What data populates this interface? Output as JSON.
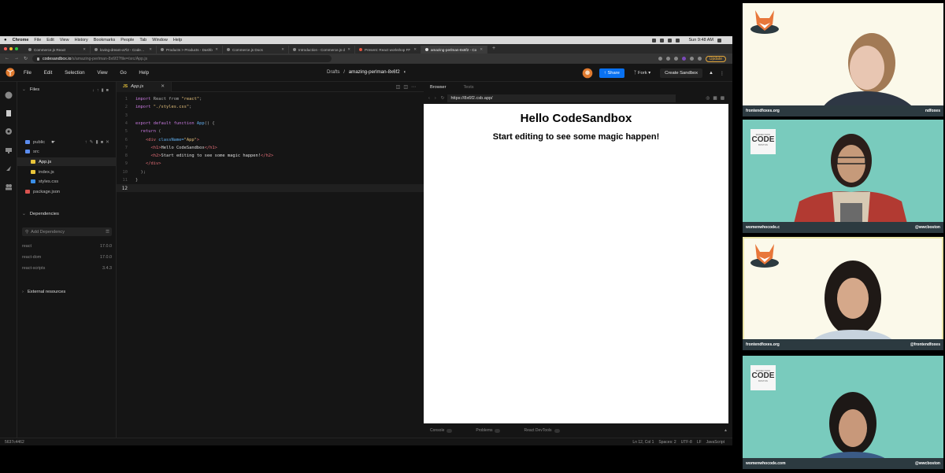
{
  "menubar": {
    "items": [
      "Chrome",
      "File",
      "Edit",
      "View",
      "History",
      "Bookmarks",
      "People",
      "Tab",
      "Window",
      "Help"
    ],
    "clock": "Sun 9:48 AM"
  },
  "browser": {
    "tabs": [
      {
        "title": "Commerce.js React"
      },
      {
        "title": "loving-dream-a7l2 - CodeSan"
      },
      {
        "title": "Products > Products - Dashb"
      },
      {
        "title": "Commerce.js Docs"
      },
      {
        "title": "Introduction - Commerce.js d"
      },
      {
        "title": "Present: React workshop FF"
      },
      {
        "title": "amazing-perlman-8x6f2 - Co"
      }
    ],
    "url_host": "codesandbox.io",
    "url_path": "/s/amazing-perlman-8x6f2?file=/src/App.js",
    "update_label": "Update"
  },
  "csb": {
    "menu": [
      "File",
      "Edit",
      "Selection",
      "View",
      "Go",
      "Help"
    ],
    "breadcrumb_folder": "Drafts",
    "breadcrumb_sep": "/",
    "sandbox_name": "amazing-perlman-8x6f2",
    "share_label": "Share",
    "fork_label": "Fork",
    "create_label": "Create Sandbox",
    "files_header": "Files",
    "tree": [
      {
        "name": "public",
        "type": "folder"
      },
      {
        "name": "src",
        "type": "folder"
      },
      {
        "name": "App.js",
        "type": "js"
      },
      {
        "name": "index.js",
        "type": "js"
      },
      {
        "name": "styles.css",
        "type": "css"
      },
      {
        "name": "package.json",
        "type": "json"
      }
    ],
    "dependencies_header": "Dependencies",
    "dep_search_placeholder": "Add Dependency",
    "dependencies": [
      {
        "name": "react",
        "version": "17.0.0"
      },
      {
        "name": "react-dom",
        "version": "17.0.0"
      },
      {
        "name": "react-scripts",
        "version": "3.4.3"
      }
    ],
    "external_header": "External resources",
    "editor_tab": "App.js",
    "code_lines": [
      {
        "n": "1",
        "a": "import",
        "b": " React from ",
        "c": "\"react\"",
        "d": ";"
      },
      {
        "n": "2",
        "a": "import",
        "b": " ",
        "c": "\"./styles.css\"",
        "d": ";"
      },
      {
        "n": "3",
        "a": "",
        "b": "",
        "c": "",
        "d": ""
      },
      {
        "n": "4",
        "a": "export default function",
        "b": " ",
        "c": "App",
        "d": "() {"
      },
      {
        "n": "5",
        "a": "  return",
        "b": " (",
        "c": "",
        "d": ""
      },
      {
        "n": "6",
        "a": "    <div",
        "b": " className=",
        "c": "\"App\"",
        "d": ">"
      },
      {
        "n": "7",
        "a": "      <h1>",
        "b": "Hello CodeSandbox",
        "c": "</h1>",
        "d": ""
      },
      {
        "n": "8",
        "a": "      <h2>",
        "b": "Start editing to see some magic happen!",
        "c": "</h2>",
        "d": ""
      },
      {
        "n": "9",
        "a": "    </div>",
        "b": "",
        "c": "",
        "d": ""
      },
      {
        "n": "10",
        "a": "  );",
        "b": "",
        "c": "",
        "d": ""
      },
      {
        "n": "11",
        "a": "}",
        "b": "",
        "c": "",
        "d": ""
      },
      {
        "n": "12",
        "a": "",
        "b": "",
        "c": "",
        "d": ""
      }
    ],
    "preview_tab": "Browser",
    "tests_tab": "Tests",
    "preview_url": "https://8x6f2.csb.app/",
    "preview_h1": "Hello CodeSandbox",
    "preview_h2": "Start editing to see some magic happen!",
    "bottom_tabs": [
      "Console",
      "Problems",
      "React DevTools"
    ],
    "status_left": "5637c4462",
    "status_right": [
      "Ln 12, Col 1",
      "Spaces: 2",
      "UTF-8",
      "LF",
      "JavaScript"
    ]
  },
  "tiles": [
    {
      "left": "frontendfoxes.org",
      "right": "ndfoxes"
    },
    {
      "left": "womenwhocode.c",
      "right": "@wwcboston",
      "logo_small": "WOMEN WHO",
      "logo_big": "CODE",
      "logo_sub": "BOSTON"
    },
    {
      "left": "frontendfoxes.org",
      "right": "@frontendfoxes"
    },
    {
      "left": "womenwhocode.com",
      "right": "@wwcboston",
      "logo_small": "WOMEN WHO",
      "logo_big": "CODE",
      "logo_sub": "BOSTON"
    }
  ]
}
